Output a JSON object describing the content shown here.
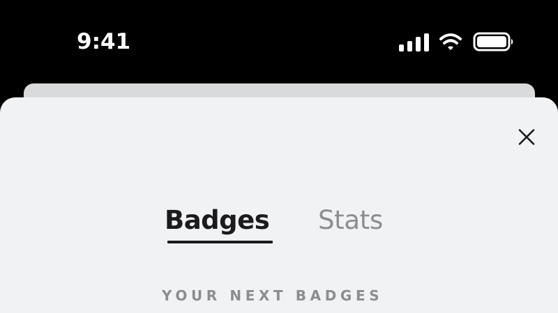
{
  "status_bar": {
    "time": "9:41",
    "icons": [
      "signal-icon",
      "wifi-icon",
      "battery-icon"
    ]
  },
  "sheet": {
    "close_icon": "close-icon",
    "tabs": [
      {
        "label": "Badges",
        "selected": true
      },
      {
        "label": "Stats",
        "selected": false
      }
    ],
    "section_heading": "YOUR NEXT BADGES"
  },
  "colors": {
    "status_background": "#000000",
    "sheet_background": "#f1f2f4",
    "back_card": "#d9dadc",
    "active_tab": "#1b1b1d",
    "inactive_tab": "#8c8d8f"
  }
}
